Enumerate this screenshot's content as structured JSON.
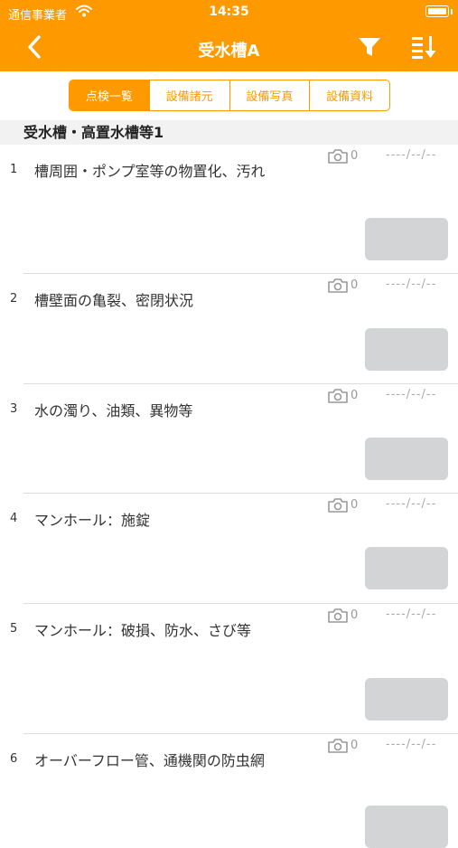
{
  "status": {
    "carrier": "通信事業者",
    "time": "14:35"
  },
  "nav": {
    "title": "受水槽A"
  },
  "tabs": [
    {
      "label": "点検一覧",
      "active": true
    },
    {
      "label": "設備諸元",
      "active": false
    },
    {
      "label": "設備写真",
      "active": false
    },
    {
      "label": "設備資料",
      "active": false
    }
  ],
  "section": {
    "title": "受水槽・高置水槽等1"
  },
  "items": [
    {
      "number": "1",
      "title": "槽周囲・ポンプ室等の物置化、汚れ",
      "photo_count": "0",
      "date": "----/--/--"
    },
    {
      "number": "2",
      "title": "槽壁面の亀裂、密閉状況",
      "photo_count": "0",
      "date": "----/--/--"
    },
    {
      "number": "3",
      "title": "水の濁り、油類、異物等",
      "photo_count": "0",
      "date": "----/--/--"
    },
    {
      "number": "4",
      "title": "マンホール：施錠",
      "photo_count": "0",
      "date": "----/--/--"
    },
    {
      "number": "5",
      "title": "マンホール：破損、防水、さび等",
      "photo_count": "0",
      "date": "----/--/--"
    },
    {
      "number": "6",
      "title": "オーバーフロー管、通機関の防虫網",
      "photo_count": "0",
      "date": "----/--/--"
    }
  ],
  "colors": {
    "accent": "#ff9900",
    "result_button": "#d2d4d6",
    "section_bg": "#f2f2f2"
  },
  "icons": [
    "wifi-icon",
    "battery-icon",
    "back-chevron-icon",
    "filter-icon",
    "sort-icon",
    "camera-icon"
  ]
}
